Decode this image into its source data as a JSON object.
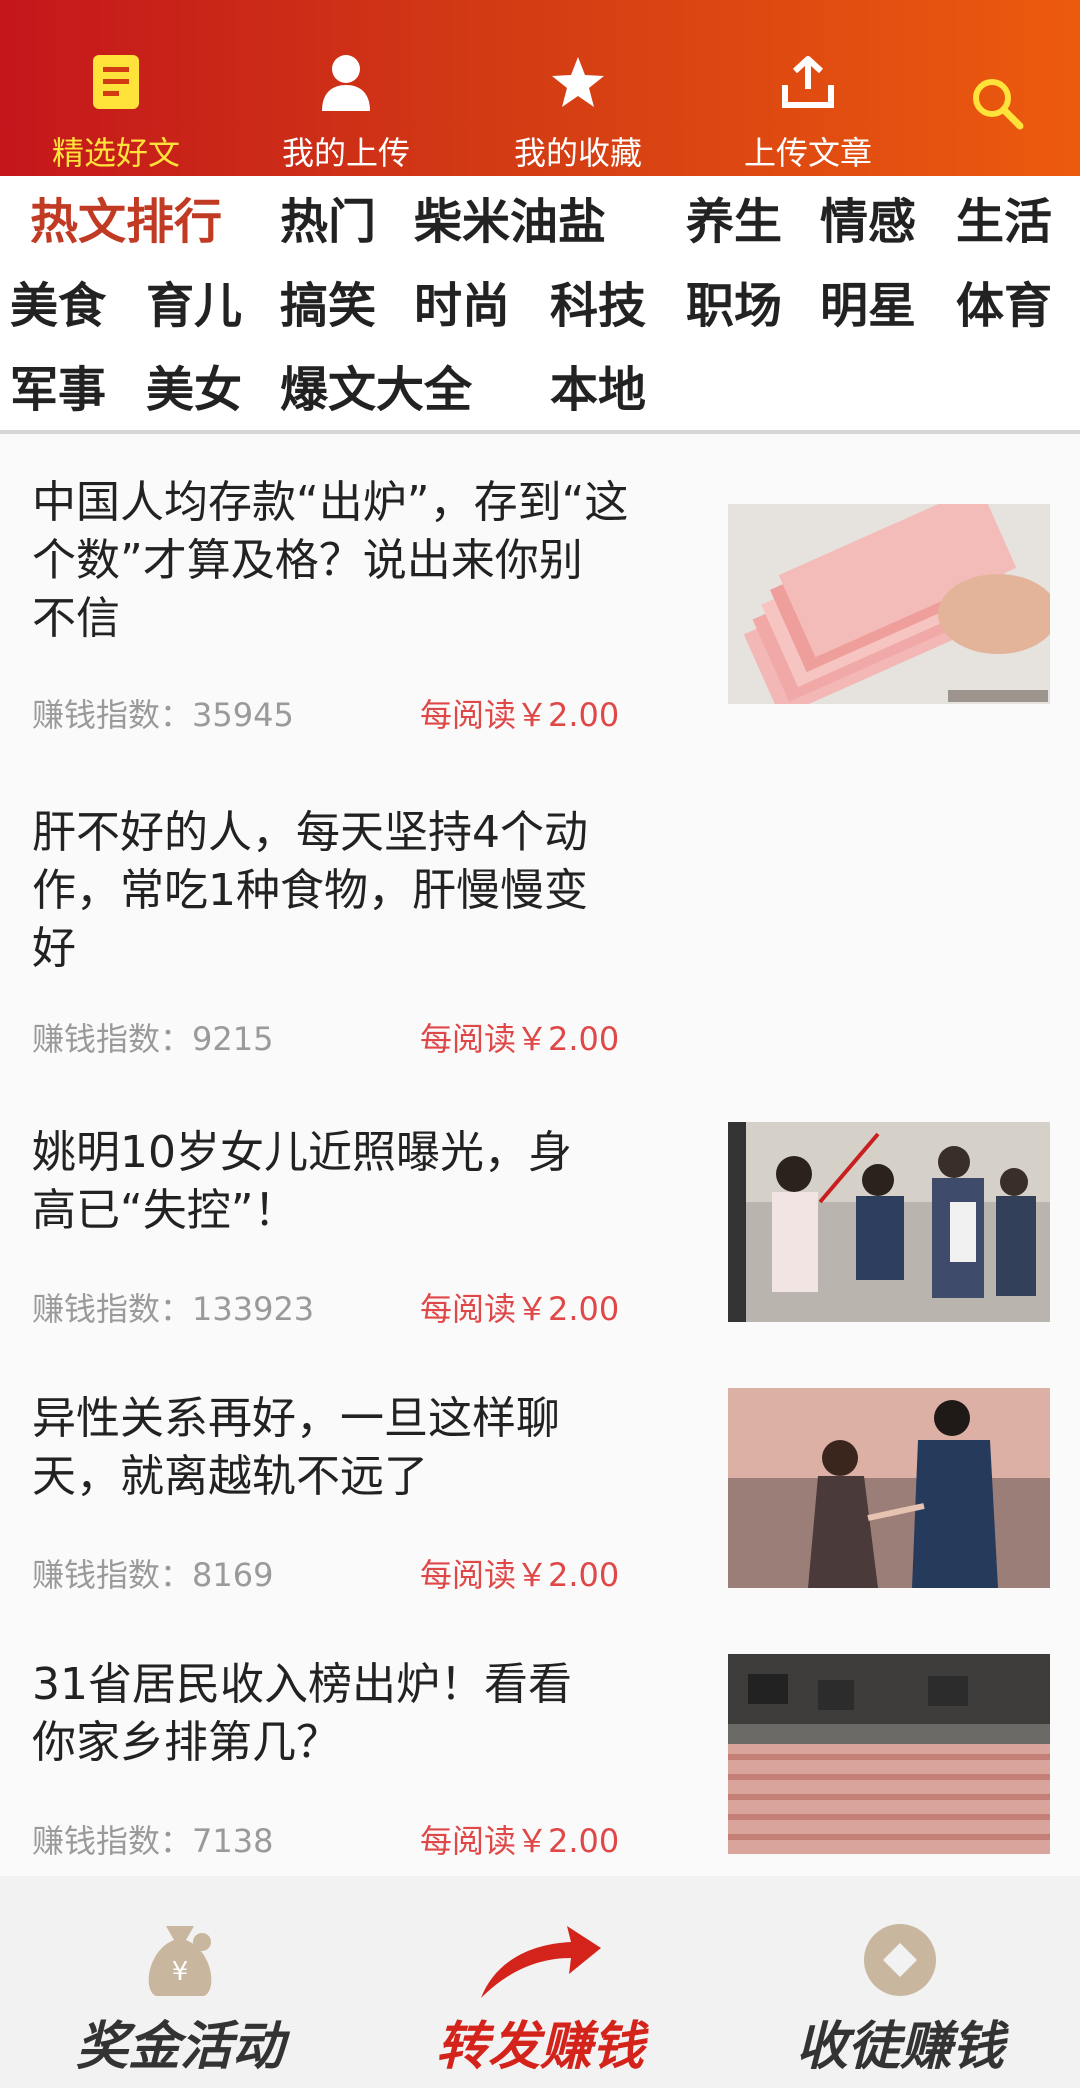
{
  "top_tabs": [
    {
      "label": "精选好文",
      "icon": "document-list-icon",
      "active": true
    },
    {
      "label": "我的上传",
      "icon": "user-icon",
      "active": false
    },
    {
      "label": "我的收藏",
      "icon": "star-icon",
      "active": false
    },
    {
      "label": "上传文章",
      "icon": "upload-icon",
      "active": false
    }
  ],
  "search_icon": "search-icon",
  "colors": {
    "header_start": "#c4161c",
    "header_end": "#ec5a0e",
    "active_tab": "#ffe23a",
    "active_category": "#c13a23",
    "price": "#e04848",
    "highlight_action": "#d4231b"
  },
  "categories": [
    {
      "label": "热文排行",
      "active": true
    },
    {
      "label": "热门"
    },
    {
      "label": "柴米油盐"
    },
    {
      "label": "养生"
    },
    {
      "label": "情感"
    },
    {
      "label": "生活"
    },
    {
      "label": "美食"
    },
    {
      "label": "育儿"
    },
    {
      "label": "搞笑"
    },
    {
      "label": "时尚"
    },
    {
      "label": "科技"
    },
    {
      "label": "职场"
    },
    {
      "label": "明星"
    },
    {
      "label": "体育"
    },
    {
      "label": "军事"
    },
    {
      "label": "美女"
    },
    {
      "label": "爆文大全"
    },
    {
      "label": "本地"
    }
  ],
  "articles": [
    {
      "title_lines": [
        "中国人均存款“出炉”，存到“这",
        "个数”才算及格？说出来你别",
        "不信"
      ],
      "index": "赚钱指数：35945",
      "price": "每阅读￥2.00",
      "thumb": "banknotes-photo"
    },
    {
      "title_lines": [
        "肝不好的人，每天坚持4个动",
        "作，常吃1种食物，肝慢慢变",
        "好"
      ],
      "index": "赚钱指数：9215",
      "price": "每阅读￥2.00",
      "thumb": ""
    },
    {
      "title_lines": [
        "姚明10岁女儿近照曝光，身",
        "高已“失控”！"
      ],
      "index": "赚钱指数：133923",
      "price": "每阅读￥2.00",
      "thumb": "crowd-photo"
    },
    {
      "title_lines": [
        "异性关系再好，一旦这样聊",
        "天，就离越轨不远了"
      ],
      "index": "赚钱指数：8169",
      "price": "每阅读￥2.00",
      "thumb": "couple-photo"
    },
    {
      "title_lines": [
        "31省居民收入榜出炉！看看",
        "你家乡排第几？"
      ],
      "index": "赚钱指数：7138",
      "price": "每阅读￥2.00",
      "thumb": "cash-stack-photo"
    }
  ],
  "bottom_bar": [
    {
      "label": "奖金活动",
      "icon": "money-bag-icon"
    },
    {
      "label": "转发赚钱",
      "icon": "share-arrow-icon"
    },
    {
      "label": "收徒赚钱",
      "icon": "coin-icon"
    }
  ]
}
